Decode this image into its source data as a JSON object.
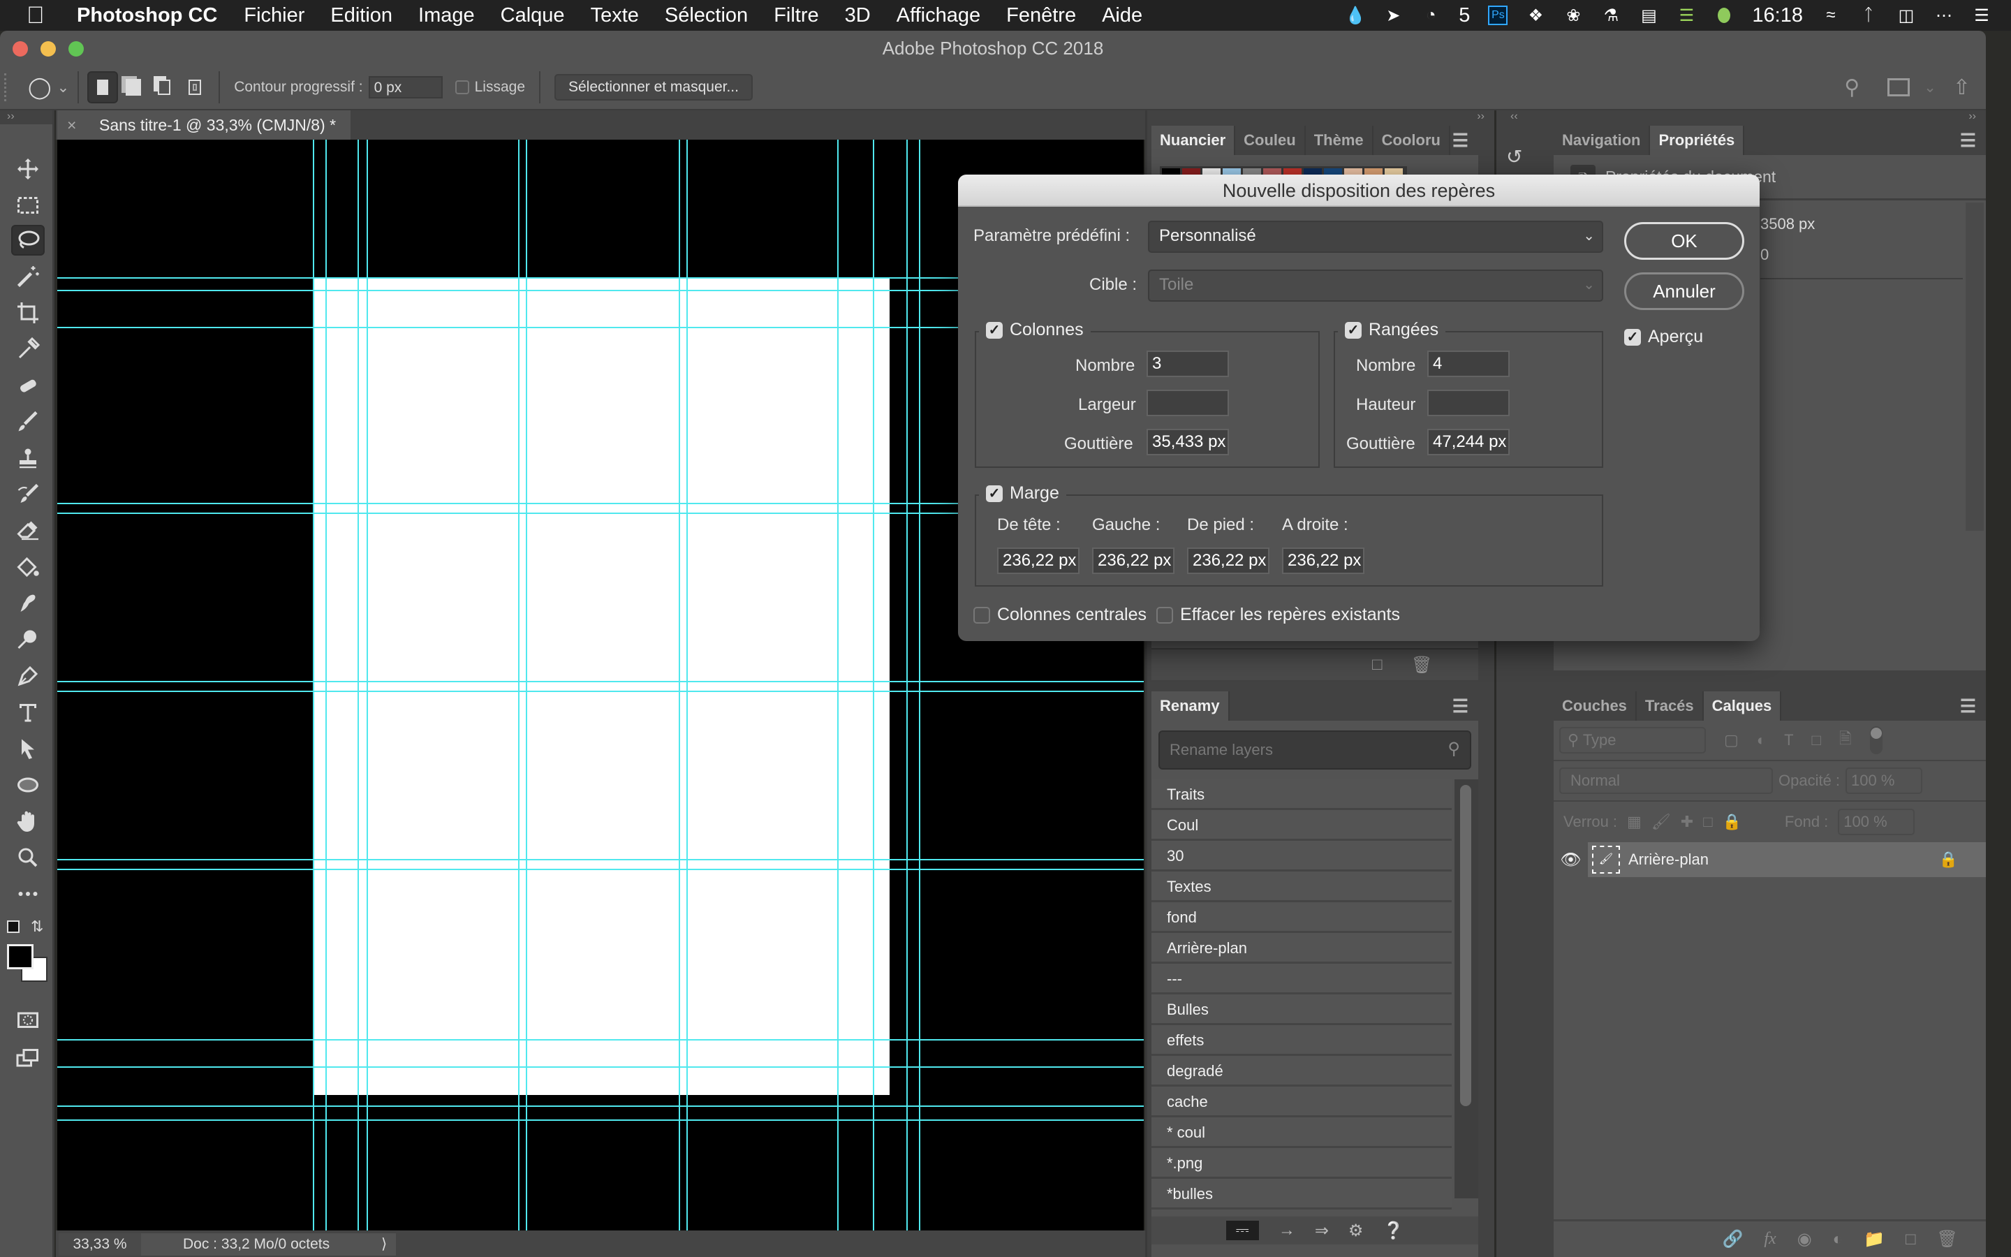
{
  "menubar": {
    "app_name": "Photoshop CC",
    "items": [
      "Fichier",
      "Edition",
      "Image",
      "Calque",
      "Texte",
      "Sélection",
      "Filtre",
      "3D",
      "Affichage",
      "Fenêtre",
      "Aide"
    ],
    "status_badge_count": "5",
    "clock": "16:18"
  },
  "window": {
    "title": "Adobe Photoshop CC 2018"
  },
  "options_bar": {
    "feather_label": "Contour progressif :",
    "feather_value": "0 px",
    "antialias_label": "Lissage",
    "antialias_checked": false,
    "select_mask_button": "Sélectionner et masquer..."
  },
  "document": {
    "tab_title": "Sans titre-1 @ 33,3% (CMJN/8) *",
    "zoom": "33,33 %",
    "doc_info": "Doc : 33,2 Mo/0 octets",
    "guide_color": "#50e8ee"
  },
  "swatches_panel": {
    "tabs": [
      "Nuancier",
      "Couleu",
      "Thème",
      "Cooloru"
    ],
    "active_tab": "Nuancier",
    "colors": [
      "#000000",
      "#8b1e1e",
      "#f2f2f2",
      "#9ccbeb",
      "#8a8a8a",
      "#b45c5c",
      "#c0322a",
      "#0e2c5a",
      "#174a80",
      "#ecc3a6",
      "#dda274",
      "#efd3a5"
    ]
  },
  "properties_panel": {
    "tabs": [
      "Navigation",
      "Propriétés"
    ],
    "active_tab": "Propriétés",
    "section_title": "Propriétés du document",
    "height_value": "3508 px",
    "partial_value": "0"
  },
  "renamy_panel": {
    "title": "Renamy",
    "search_placeholder": "Rename layers",
    "items": [
      "Traits",
      "Coul",
      "30",
      "Textes",
      "fond",
      "Arrière-plan",
      "---",
      "Bulles",
      "effets",
      "degradé",
      "cache",
      "* coul",
      "*.png",
      "*bulles"
    ]
  },
  "layers_panel": {
    "tabs": [
      "Couches",
      "Tracés",
      "Calques"
    ],
    "active_tab": "Calques",
    "filter_label": "Type",
    "blend_mode": "Normal",
    "opacity_label": "Opacité :",
    "opacity_value": "100 %",
    "lock_label": "Verrou :",
    "fill_label": "Fond :",
    "fill_value": "100 %",
    "layers": [
      {
        "name": "Arrière-plan",
        "visible": true,
        "locked": true
      }
    ]
  },
  "dialog": {
    "title": "Nouvelle disposition des repères",
    "preset_label": "Paramètre prédéfini :",
    "preset_value": "Personnalisé",
    "target_label": "Cible :",
    "target_value": "Toile",
    "ok": "OK",
    "cancel": "Annuler",
    "preview_label": "Aperçu",
    "preview_checked": true,
    "columns": {
      "label": "Colonnes",
      "checked": true,
      "number_label": "Nombre",
      "number": "3",
      "width_label": "Largeur",
      "width": "",
      "gutter_label": "Gouttière",
      "gutter": "35,433 px"
    },
    "rows": {
      "label": "Rangées",
      "checked": true,
      "number_label": "Nombre",
      "number": "4",
      "height_label": "Hauteur",
      "height": "",
      "gutter_label": "Gouttière",
      "gutter": "47,244 px"
    },
    "margin": {
      "label": "Marge",
      "checked": true,
      "top_label": "De tête :",
      "left_label": "Gauche :",
      "bottom_label": "De pied :",
      "right_label": "A droite :",
      "top": "236,22 px",
      "left": "236,22 px",
      "bottom": "236,22 px",
      "right": "236,22 px"
    },
    "center_columns_label": "Colonnes centrales",
    "center_columns_checked": false,
    "clear_guides_label": "Effacer les repères existants",
    "clear_guides_checked": false
  }
}
